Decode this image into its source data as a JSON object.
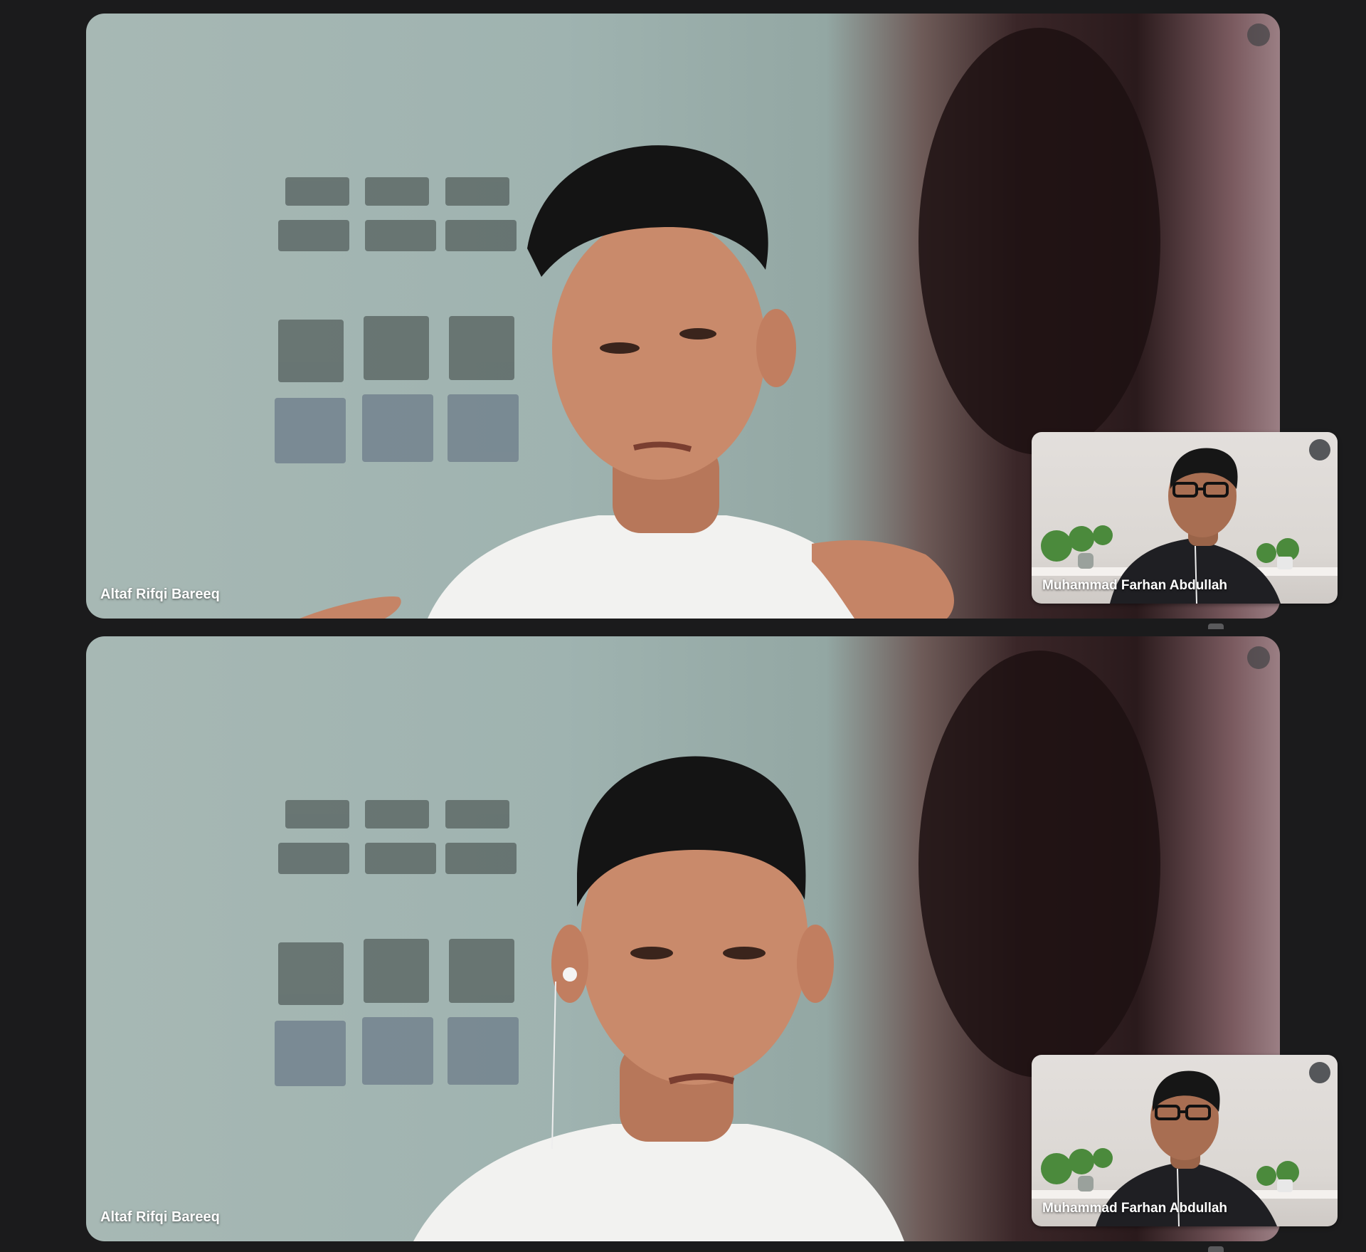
{
  "participants": {
    "main_name": "Altaf Rifqi Bareeq",
    "self_name": "Muhammad Farhan Abdullah"
  },
  "tiles": [
    {
      "main_label": "Altaf Rifqi Bareeq",
      "pip_label": "Muhammad Farhan Abdullah",
      "pip_mic": "mic-off-icon"
    },
    {
      "main_label": "Altaf Rifqi Bareeq",
      "pip_label": "Muhammad Farhan Abdullah",
      "pip_mic": "mic-off-icon"
    }
  ],
  "colors": {
    "background": "#1b1b1c",
    "label_text": "#ffffff",
    "mic_badge": "#3c4043"
  }
}
